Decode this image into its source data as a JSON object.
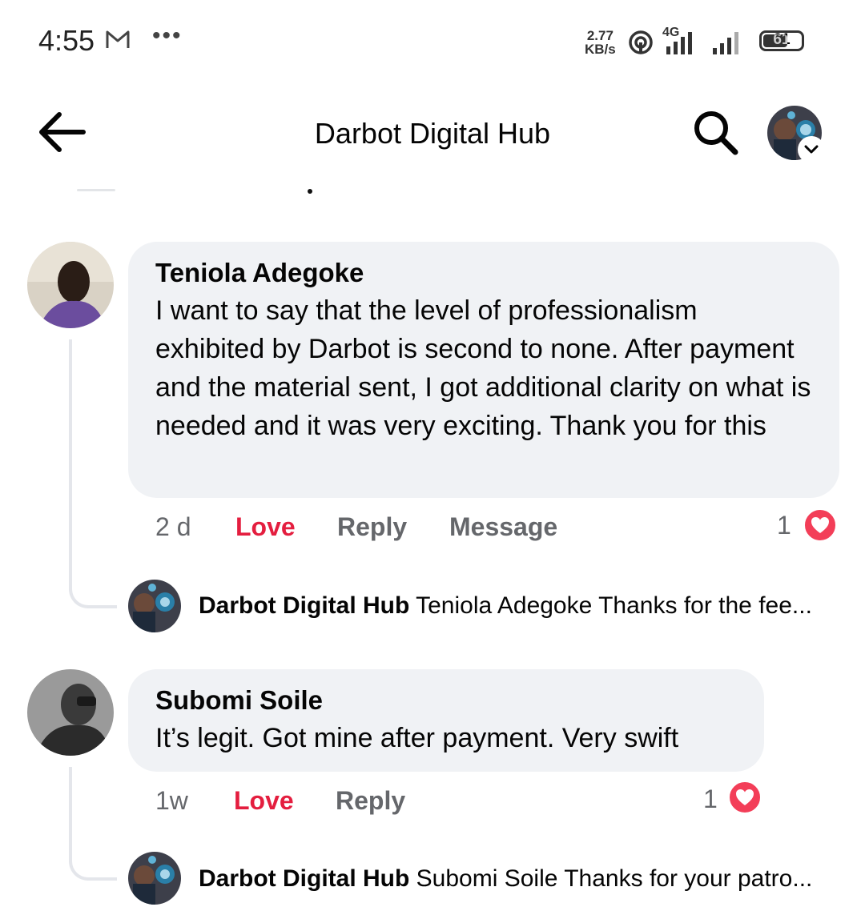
{
  "status_bar": {
    "time": "4:55",
    "speed_value": "2.77",
    "speed_unit": "KB/s",
    "network": "4G",
    "battery": "61",
    "icons": [
      "gmail-icon",
      "more-dots-icon",
      "hotspot-icon",
      "signal-icon",
      "battery-icon"
    ]
  },
  "header": {
    "title": "Darbot Digital Hub",
    "icons": [
      "back-arrow-icon",
      "search-icon",
      "page-avatar",
      "chevron-down-icon"
    ]
  },
  "comments": [
    {
      "author": "Teniola Adegoke",
      "text": "I want to say that the level of professionalism exhibited by Darbot is second to none. After payment and the material sent, I got additional clarity on what is needed and it was very exciting. Thank you for this",
      "time": "2 d",
      "actions": {
        "love": "Love",
        "reply": "Reply",
        "message": "Message"
      },
      "reaction_count": "1",
      "reply": {
        "author": "Darbot Digital Hub",
        "preview": "Teniola Adegoke Thanks for the fee..."
      }
    },
    {
      "author": "Subomi Soile",
      "text": "It’s legit. Got mine after payment. Very swift",
      "time": "1w",
      "actions": {
        "love": "Love",
        "reply": "Reply"
      },
      "reaction_count": "1",
      "reply": {
        "author": "Darbot Digital Hub",
        "preview": "Subomi Soile Thanks for your patro..."
      }
    }
  ],
  "colors": {
    "love_red": "#e41e3f",
    "heart": "#f33e58",
    "bubble": "#f0f2f5",
    "meta_gray": "#65676b"
  }
}
